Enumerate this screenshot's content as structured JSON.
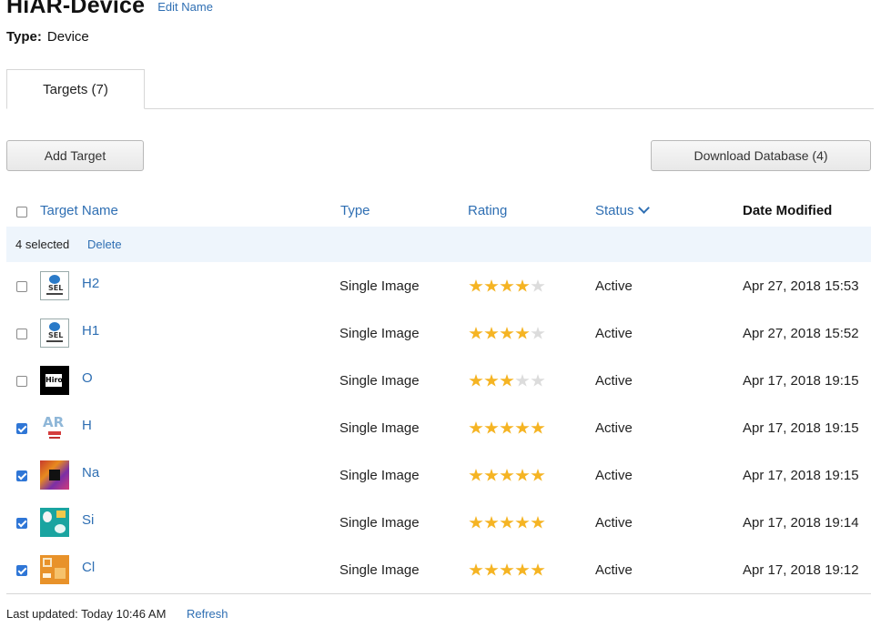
{
  "device": {
    "title": "HiAR-Device",
    "edit_label": "Edit Name",
    "type_label": "Type:",
    "type_value": "Device"
  },
  "tabs": [
    {
      "label": "Targets (7)"
    }
  ],
  "toolbar": {
    "add_label": "Add Target",
    "download_label": "Download Database (4)"
  },
  "table": {
    "headers": {
      "name": "Target Name",
      "type": "Type",
      "rating": "Rating",
      "status": "Status",
      "date": "Date Modified"
    },
    "selection": {
      "count_text": "4 selected",
      "delete_label": "Delete"
    },
    "rows": [
      {
        "name": "H2",
        "type": "Single Image",
        "rating": 4,
        "status": "Active",
        "date": "Apr 27, 2018 15:53",
        "checked": false,
        "thumb": "sel-logo"
      },
      {
        "name": "H1",
        "type": "Single Image",
        "rating": 4,
        "status": "Active",
        "date": "Apr 27, 2018 15:52",
        "checked": false,
        "thumb": "sel-logo"
      },
      {
        "name": "O",
        "type": "Single Image",
        "rating": 3,
        "status": "Active",
        "date": "Apr 17, 2018 19:15",
        "checked": false,
        "thumb": "hiro-marker"
      },
      {
        "name": "H",
        "type": "Single Image",
        "rating": 5,
        "status": "Active",
        "date": "Apr 17, 2018 19:15",
        "checked": true,
        "thumb": "ar-logo"
      },
      {
        "name": "Na",
        "type": "Single Image",
        "rating": 5,
        "status": "Active",
        "date": "Apr 17, 2018 19:15",
        "checked": true,
        "thumb": "colorful-pattern"
      },
      {
        "name": "Si",
        "type": "Single Image",
        "rating": 5,
        "status": "Active",
        "date": "Apr 17, 2018 19:14",
        "checked": true,
        "thumb": "teal-illustration"
      },
      {
        "name": "Cl",
        "type": "Single Image",
        "rating": 5,
        "status": "Active",
        "date": "Apr 17, 2018 19:12",
        "checked": true,
        "thumb": "orange-poster"
      }
    ]
  },
  "thumb_text": {
    "sel": "SEL",
    "hiro": "Hiro",
    "ar": "AR"
  },
  "footer": {
    "last_updated": "Last updated: Today 10:46 AM",
    "refresh_label": "Refresh"
  },
  "colors": {
    "link": "#2f6fb3",
    "star_on": "#f5b423",
    "star_off": "#dcdcdc",
    "checkbox_checked": "#2f76d6",
    "selection_bar": "#eef5fc"
  }
}
